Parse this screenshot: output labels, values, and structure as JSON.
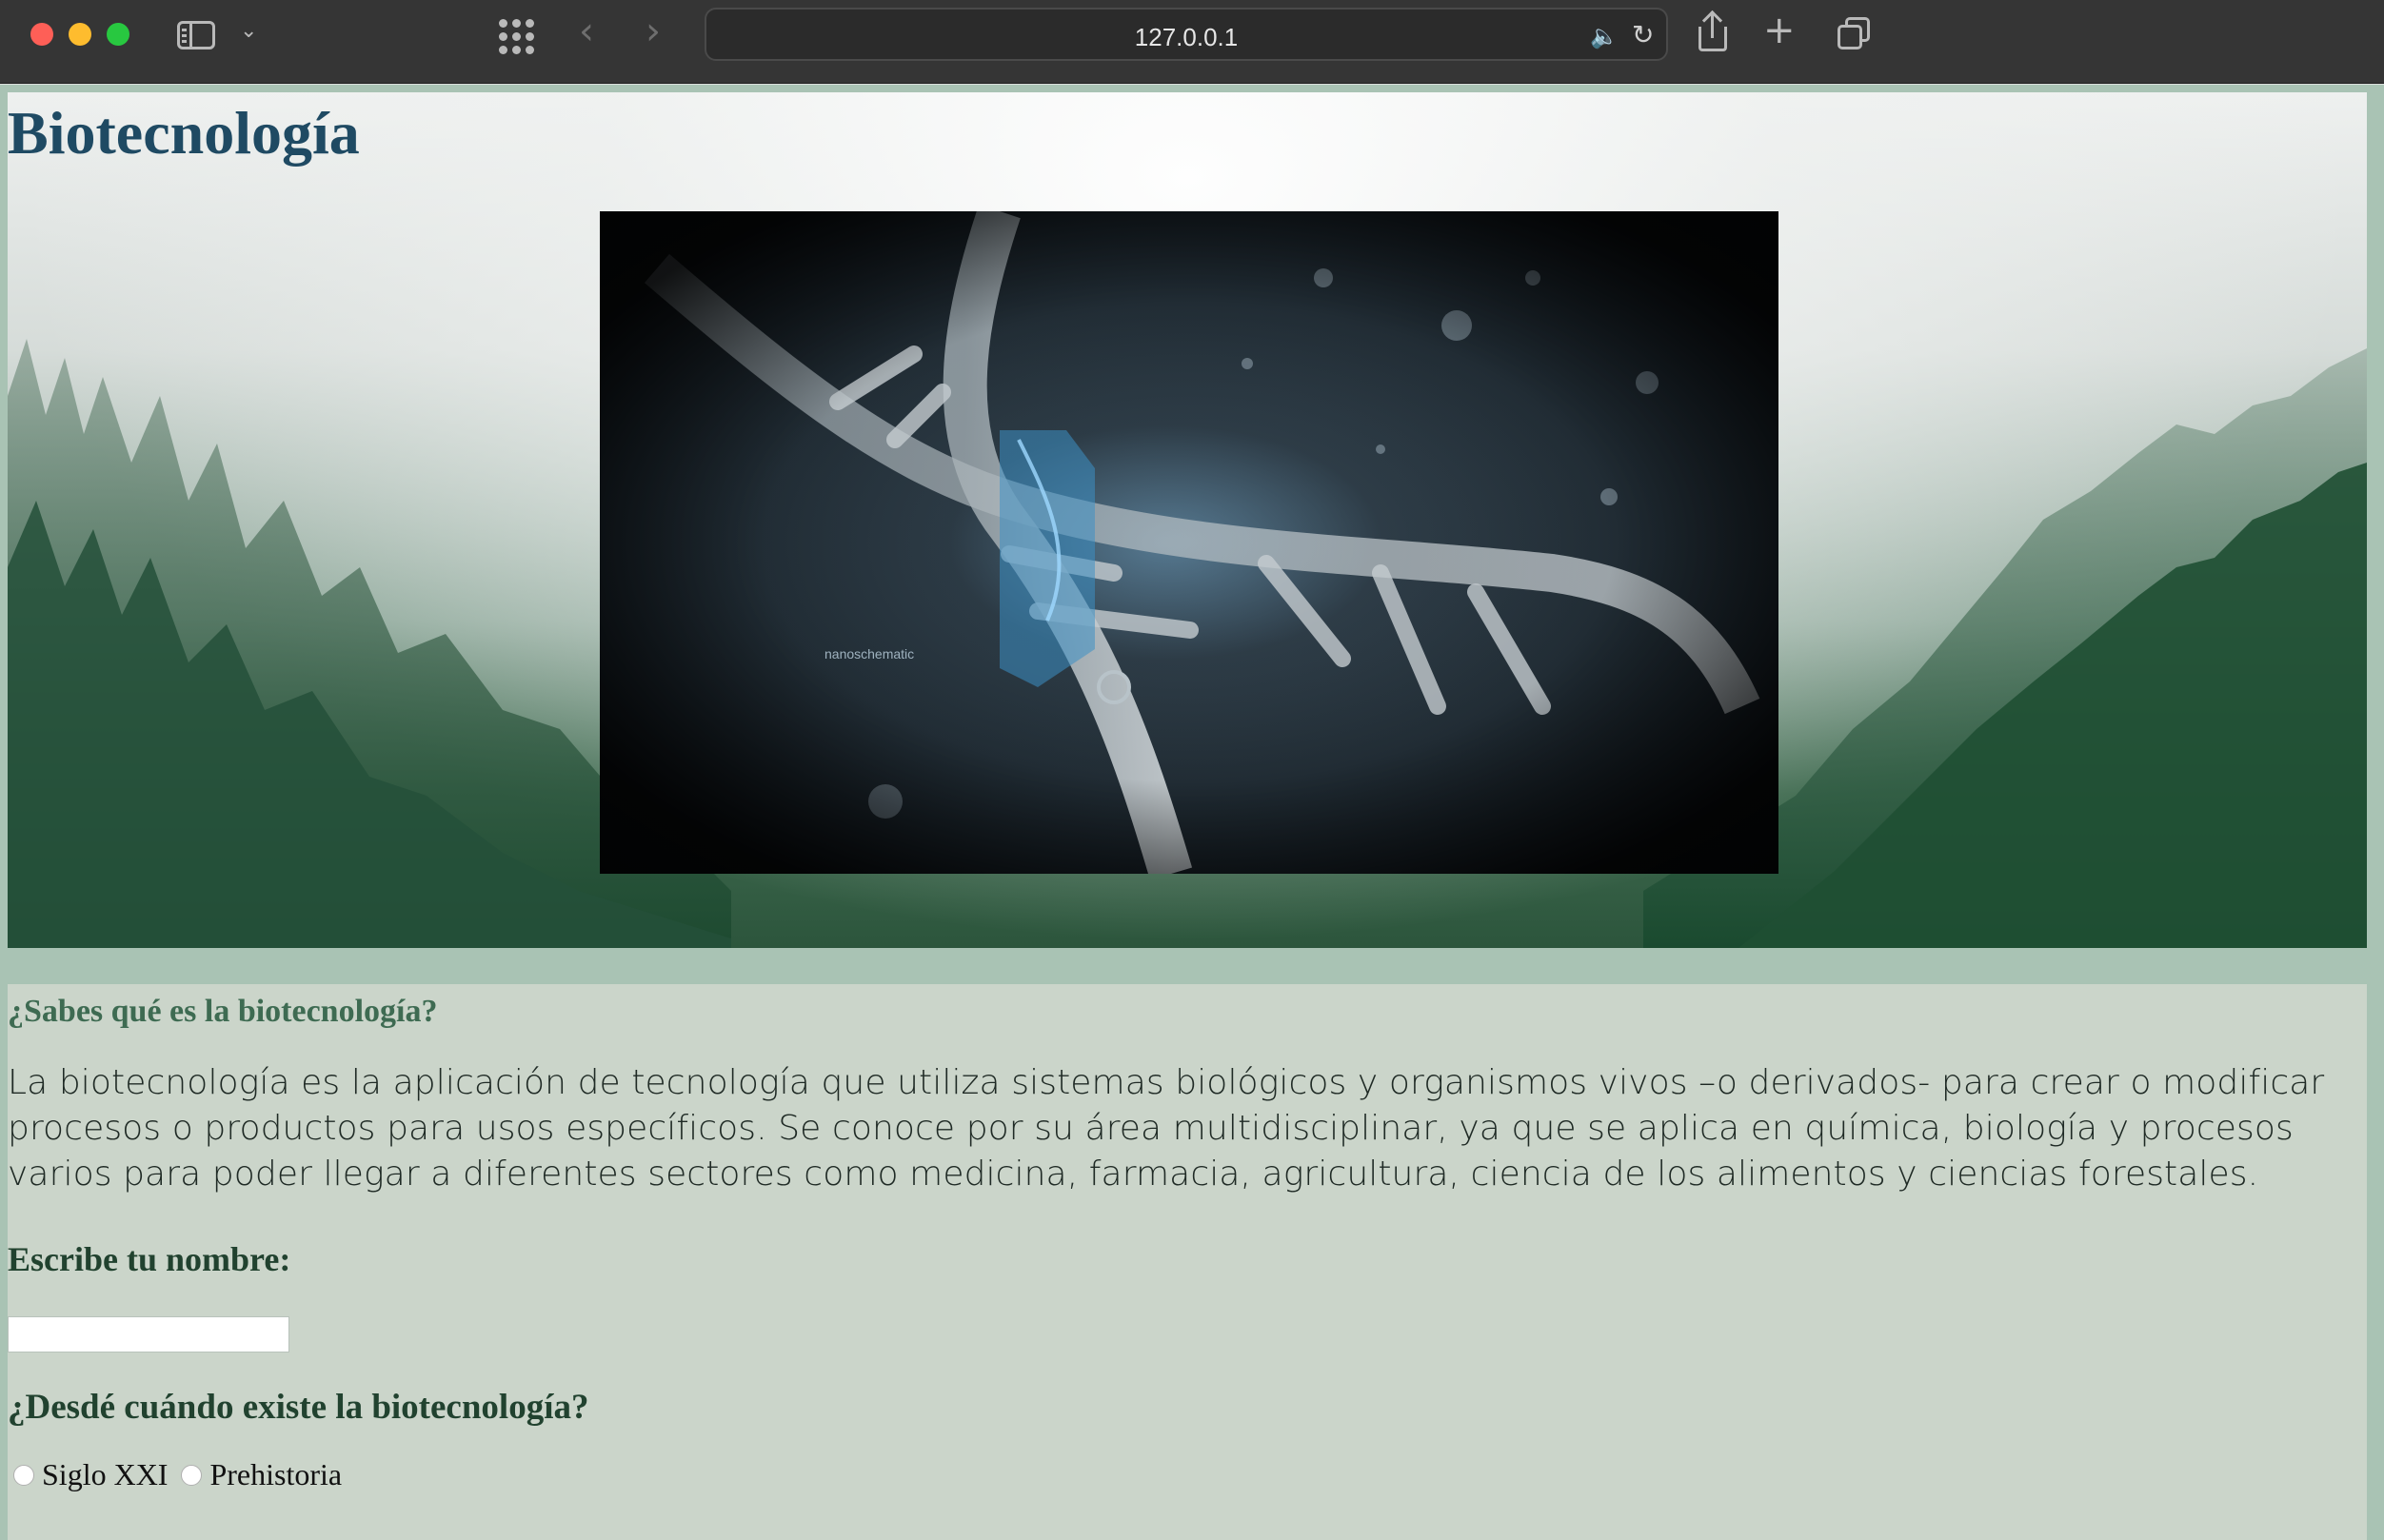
{
  "browser": {
    "url": "127.0.0.1"
  },
  "page": {
    "title": "Biotecnología",
    "hero_image": {
      "overlay_text": "nanoschematic"
    },
    "section": {
      "question": "¿Sabes qué es la biotecnología?",
      "paragraph": "La biotecnología es la aplicación de tecnología que utiliza sistemas biológicos y organismos vivos –o derivados- para crear o modificar procesos o productos para usos específicos. Se conoce por su área multidisciplinar, ya que se aplica en química, biología y procesos varios para poder llegar a diferentes sectores como medicina, farmacia, agricultura, ciencia de los alimentos y ciencias forestales."
    },
    "form": {
      "name_label": "Escribe tu nombre:",
      "name_value": "",
      "question": "¿Desdé cuándo existe la biotecnología?",
      "options": [
        "Siglo XXI",
        "Prehistoria"
      ]
    }
  },
  "colors": {
    "title": "#1f4a63",
    "page_background": "#a9c3b4",
    "content_background": "#cbd5ca",
    "heading_green": "#3e6b52"
  }
}
